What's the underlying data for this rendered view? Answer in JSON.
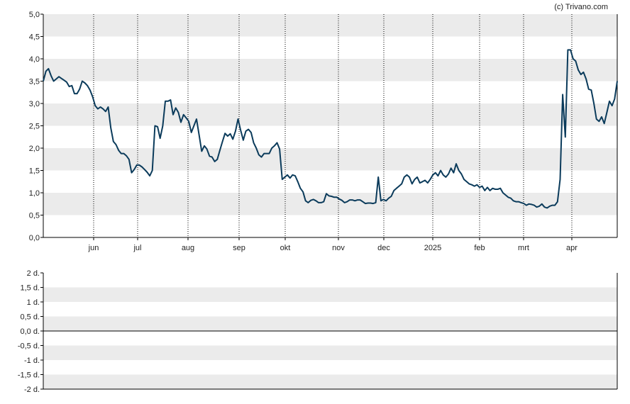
{
  "copyright": "(c) Trivano.com",
  "colors": {
    "line": "#0b3b5b",
    "band": "#ebebeb",
    "axis": "#000000",
    "gridline": "#000000"
  },
  "chart_data": [
    {
      "type": "line",
      "title": "",
      "ylim": [
        0,
        5
      ],
      "yticks": [
        "0,0",
        "0,5",
        "1,0",
        "1,5",
        "2,0",
        "2,5",
        "3,0",
        "3,5",
        "4,0",
        "4,5",
        "5,0"
      ],
      "xticks": [
        "jun",
        "jul",
        "aug",
        "sep",
        "okt",
        "nov",
        "dec",
        "2025",
        "feb",
        "mrt",
        "apr"
      ],
      "grid": "vertical dotted at month ticks; alternating horizontal bands",
      "series": [
        {
          "values": [
            3.5,
            3.72,
            3.78,
            3.62,
            3.5,
            3.55,
            3.6,
            3.56,
            3.52,
            3.48,
            3.38,
            3.4,
            3.22,
            3.22,
            3.32,
            3.5,
            3.46,
            3.4,
            3.3,
            3.15,
            2.95,
            2.88,
            2.92,
            2.88,
            2.82,
            2.92,
            2.45,
            2.15,
            2.08,
            1.95,
            1.88,
            1.88,
            1.83,
            1.75,
            1.45,
            1.52,
            1.62,
            1.62,
            1.58,
            1.52,
            1.46,
            1.38,
            1.5,
            2.5,
            2.48,
            2.22,
            2.5,
            3.05,
            3.05,
            3.08,
            2.75,
            2.9,
            2.8,
            2.58,
            2.75,
            2.68,
            2.6,
            2.35,
            2.5,
            2.65,
            2.3,
            1.93,
            2.05,
            1.98,
            1.82,
            1.8,
            1.7,
            1.75,
            1.95,
            2.15,
            2.33,
            2.27,
            2.32,
            2.2,
            2.38,
            2.65,
            2.4,
            2.18,
            2.38,
            2.42,
            2.35,
            2.12,
            2.0,
            1.85,
            1.8,
            1.88,
            1.88,
            1.88,
            2.0,
            2.05,
            2.12,
            1.98,
            1.3,
            1.35,
            1.4,
            1.33,
            1.4,
            1.38,
            1.25,
            1.1,
            1.02,
            0.82,
            0.78,
            0.83,
            0.85,
            0.82,
            0.78,
            0.78,
            0.8,
            0.98,
            0.93,
            0.92,
            0.9,
            0.9,
            0.86,
            0.83,
            0.78,
            0.8,
            0.84,
            0.84,
            0.82,
            0.84,
            0.84,
            0.8,
            0.76,
            0.77,
            0.77,
            0.76,
            0.78,
            1.35,
            0.82,
            0.85,
            0.82,
            0.88,
            0.92,
            1.05,
            1.1,
            1.15,
            1.2,
            1.35,
            1.4,
            1.35,
            1.2,
            1.3,
            1.35,
            1.22,
            1.25,
            1.28,
            1.22,
            1.3,
            1.4,
            1.45,
            1.38,
            1.5,
            1.4,
            1.35,
            1.42,
            1.55,
            1.45,
            1.65,
            1.5,
            1.42,
            1.3,
            1.25,
            1.2,
            1.18,
            1.15,
            1.18,
            1.12,
            1.15,
            1.05,
            1.12,
            1.05,
            1.1,
            1.08,
            1.08,
            1.1,
            1.0,
            0.95,
            0.9,
            0.88,
            0.82,
            0.8,
            0.8,
            0.78,
            0.76,
            0.72,
            0.75,
            0.74,
            0.72,
            0.68,
            0.7,
            0.75,
            0.68,
            0.66,
            0.7,
            0.72,
            0.72,
            0.8,
            1.3,
            3.2,
            2.25,
            4.2,
            4.2,
            4.0,
            3.95,
            3.75,
            3.65,
            3.7,
            3.55,
            3.32,
            3.3,
            3.0,
            2.65,
            2.6,
            2.7,
            2.55,
            2.8,
            3.05,
            2.95,
            3.1,
            3.5
          ]
        }
      ]
    },
    {
      "type": "line",
      "title": "",
      "ylim": [
        -2,
        2
      ],
      "yticks": [
        "-2 d.",
        "-1,5 d.",
        "-1 d.",
        "-0,5 d.",
        "0,0 d.",
        "0,5 d.",
        "1 d.",
        "1,5 d.",
        "2 d."
      ],
      "grid": "alternating horizontal bands; zero line",
      "series": []
    }
  ]
}
